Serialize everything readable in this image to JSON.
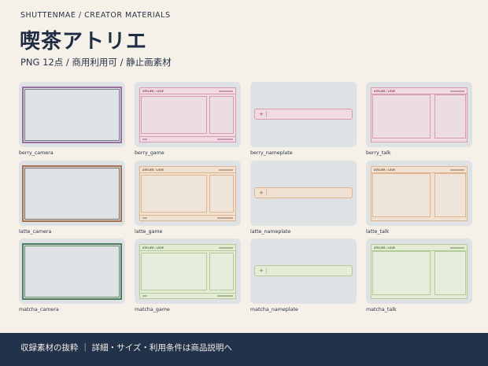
{
  "header": {
    "brand": "SHUTTENMAE  /  CREATOR MATERIALS",
    "title": "喫茶アトリエ",
    "subtitle": "PNG 12点  /  商用利用可  /  静止画素材"
  },
  "panel_text": {
    "heading": "ATELIER / LOVE"
  },
  "nameplate_icon": "+",
  "items": [
    {
      "label": "berry_camera",
      "theme": "berry",
      "kind": "camera"
    },
    {
      "label": "berry_game",
      "theme": "berry",
      "kind": "game"
    },
    {
      "label": "berry_nameplate",
      "theme": "berry",
      "kind": "nameplate"
    },
    {
      "label": "berry_talk",
      "theme": "berry",
      "kind": "talk"
    },
    {
      "label": "latte_camera",
      "theme": "latte",
      "kind": "camera"
    },
    {
      "label": "latte_game",
      "theme": "latte",
      "kind": "game"
    },
    {
      "label": "latte_nameplate",
      "theme": "latte",
      "kind": "nameplate"
    },
    {
      "label": "latte_talk",
      "theme": "latte",
      "kind": "talk"
    },
    {
      "label": "matcha_camera",
      "theme": "matcha",
      "kind": "camera"
    },
    {
      "label": "matcha_game",
      "theme": "matcha",
      "kind": "game"
    },
    {
      "label": "matcha_nameplate",
      "theme": "matcha",
      "kind": "nameplate"
    },
    {
      "label": "matcha_talk",
      "theme": "matcha",
      "kind": "talk"
    }
  ],
  "themes": {
    "berry": {
      "accent": "#d99ab3"
    },
    "latte": {
      "accent": "#e0b48c"
    },
    "matcha": {
      "accent": "#b3cb97"
    }
  },
  "footer": {
    "text": "収録素材の抜粋   ｜   詳細・サイズ・利用条件は商品説明へ"
  },
  "colors": {
    "background": "#f5f0e8",
    "footer_bg": "#22324a",
    "thumb_bg": "#dfe2e4"
  }
}
